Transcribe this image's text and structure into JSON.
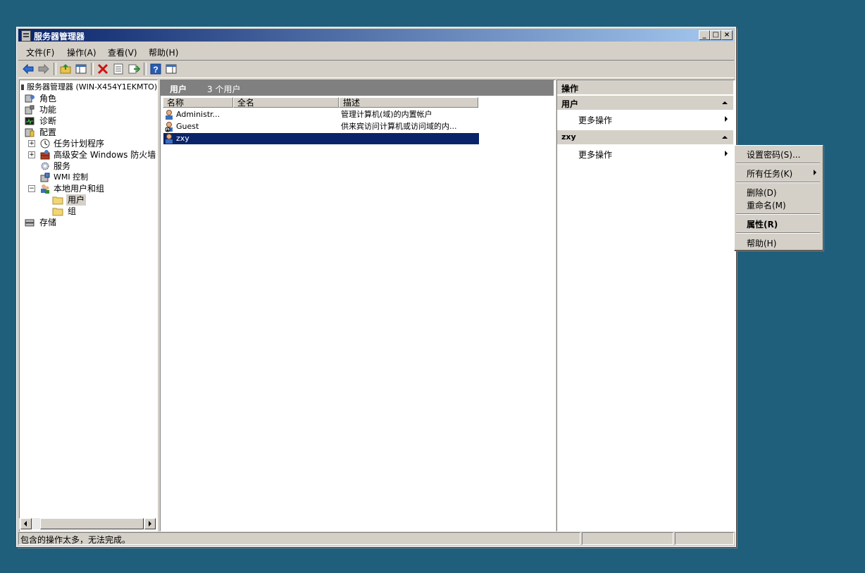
{
  "window": {
    "title": "服务器管理器",
    "controls": {
      "minimize": "_",
      "maximize": "□",
      "close": "×"
    }
  },
  "menubar": {
    "file": "文件(F)",
    "action": "操作(A)",
    "view": "查看(V)",
    "help": "帮助(H)"
  },
  "toolbar": {
    "icons": [
      "back-icon",
      "forward-icon",
      "up-folder-icon",
      "show-hide-tree-icon",
      "delete-icon",
      "properties-icon",
      "export-icon",
      "help-icon",
      "show-hide-action-pane-icon"
    ]
  },
  "tree": {
    "root": "服务器管理器 (WIN-X454Y1EKMTO)",
    "roles": "角色",
    "features": "功能",
    "diagnostics": "诊断",
    "configuration": "配置",
    "task_scheduler": "任务计划程序",
    "firewall": "高级安全 Windows 防火墙",
    "services": "服务",
    "wmi": "WMI 控制",
    "local_users": "本地用户和组",
    "users": "用户",
    "groups": "组",
    "storage": "存储"
  },
  "list": {
    "header_title": "用户",
    "header_count": "3 个用户",
    "columns": {
      "name": "名称",
      "fullname": "全名",
      "desc": "描述"
    },
    "rows": [
      {
        "name": "Administr...",
        "fullname": "",
        "desc": "管理计算机(域)的内置帐户",
        "selected": false
      },
      {
        "name": "Guest",
        "fullname": "",
        "desc": "供来宾访问计算机或访问域的内...",
        "selected": false
      },
      {
        "name": "zxy",
        "fullname": "",
        "desc": "",
        "selected": true
      }
    ]
  },
  "actions": {
    "title": "操作",
    "section1": "用户",
    "more1": "更多操作",
    "section2": "zxy",
    "more2": "更多操作"
  },
  "context_menu": {
    "set_password": "设置密码(S)...",
    "all_tasks": "所有任务(K)",
    "delete": "删除(D)",
    "rename": "重命名(M)",
    "properties": "属性(R)",
    "help": "帮助(H)"
  },
  "status": {
    "text": "包含的操作太多，无法完成。"
  }
}
